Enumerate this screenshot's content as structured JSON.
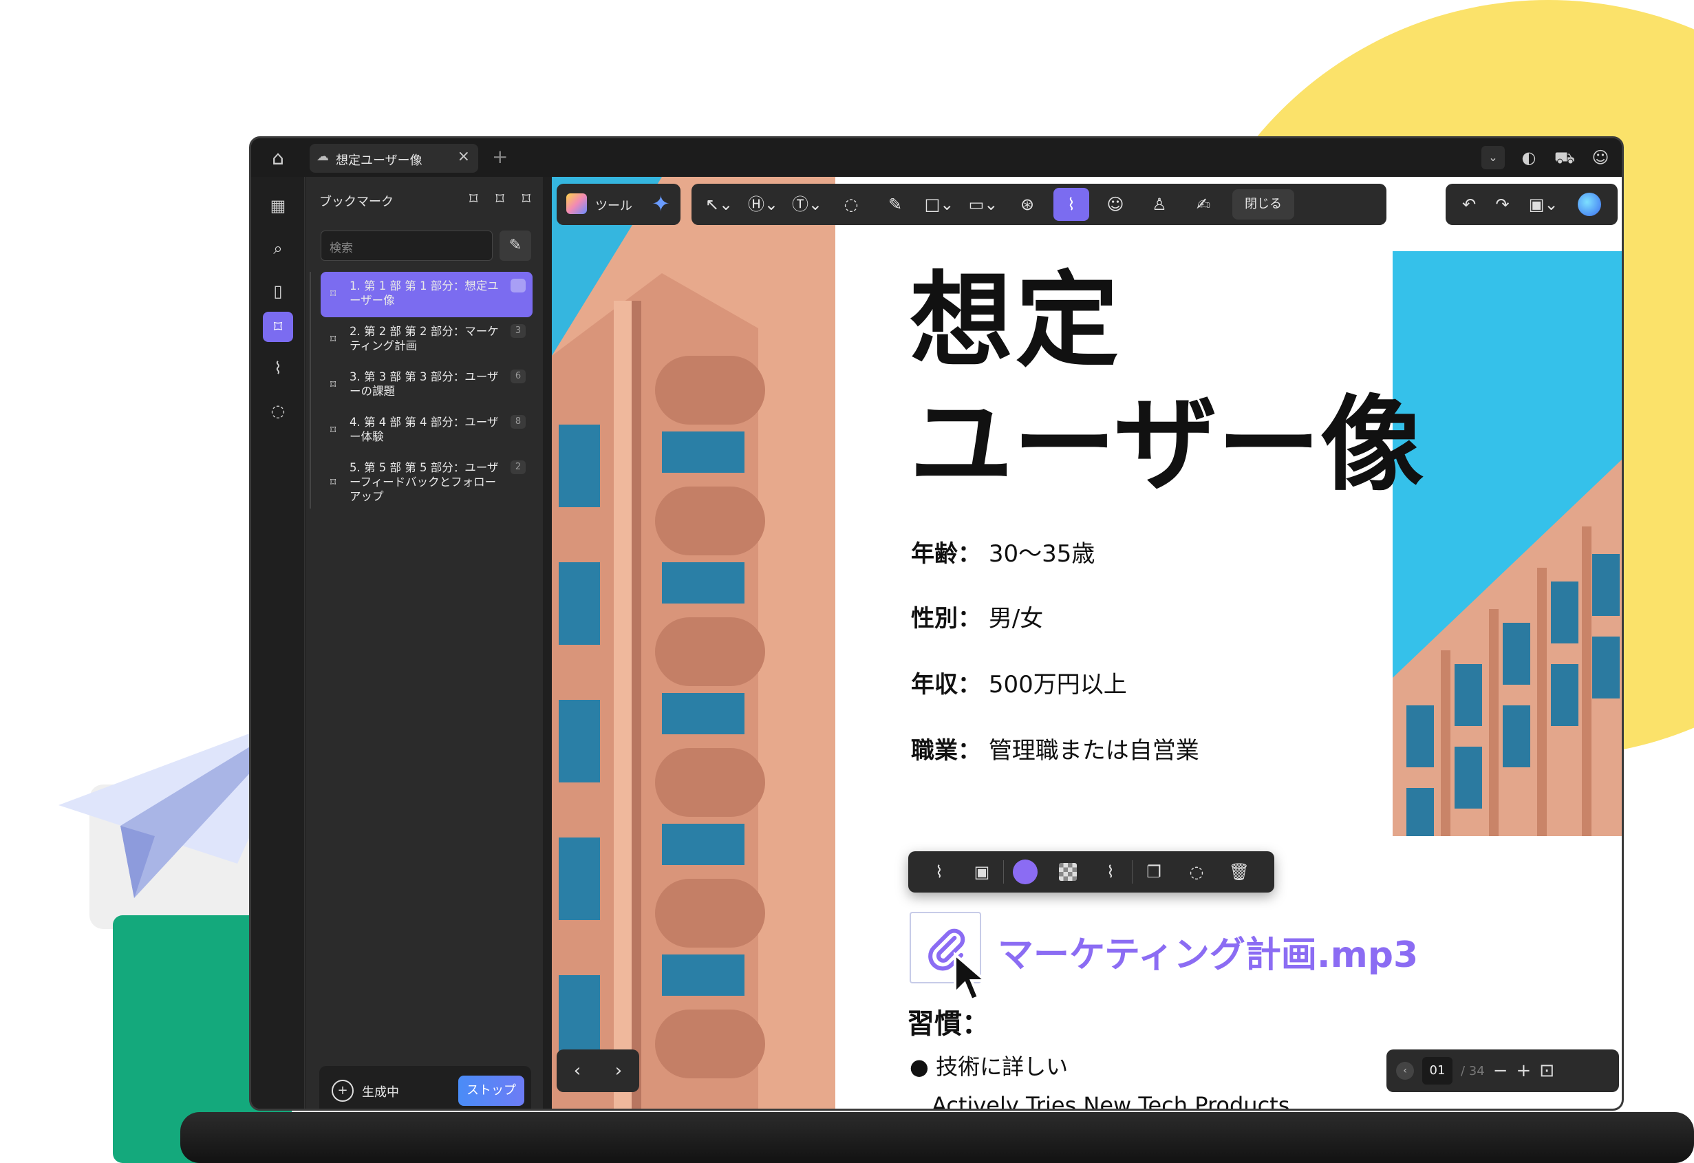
{
  "tab": {
    "title": "想定ユーザー像"
  },
  "panel": {
    "title": "ブックマーク",
    "search_placeholder": "検索",
    "bookmarks": [
      {
        "label": "1. 第 1 部 第 1 部分：想定ユーザー像",
        "count": ""
      },
      {
        "label": "2. 第 2 部 第 2 部分：マーケティング計画",
        "count": "3"
      },
      {
        "label": "3. 第 3 部 第 3 部分：ユーザーの課題",
        "count": "6"
      },
      {
        "label": "4. 第 4 部 第 4 部分：ユーザー体験",
        "count": "8"
      },
      {
        "label": "5. 第 5 部 第 5 部分：ユーザーフィードバックとフォローアップ",
        "count": "2"
      }
    ],
    "generating_label": "生成中",
    "stop_label": "ストップ"
  },
  "toolbar": {
    "tools_label": "ツール",
    "close_label": "閉じる"
  },
  "document": {
    "title_line1": "想定",
    "title_line2": "ユーザー像",
    "fields": [
      {
        "label": "年齢：",
        "value": "30〜35歳"
      },
      {
        "label": "性別：",
        "value": "男/女"
      },
      {
        "label": "年収：",
        "value": "500万円以上"
      },
      {
        "label": "職業：",
        "value": "管理職または自営業"
      }
    ],
    "attachment_name": "マーケティング計画.mp3",
    "habits_heading": "習慣：",
    "habit_1": "技術に詳しい",
    "habit_2": "Actively Tries New Tech Products"
  },
  "pagination": {
    "current": "01",
    "total": "/ 34"
  },
  "colors": {
    "accent": "#7b6cf0",
    "attachment": "#8b6cf3",
    "stop_button": "#4a8cf7"
  },
  "icons": {
    "rail": [
      "grid-icon",
      "search-icon",
      "page-icon",
      "bookmark-icon",
      "attachment-icon",
      "comment-icon"
    ]
  }
}
